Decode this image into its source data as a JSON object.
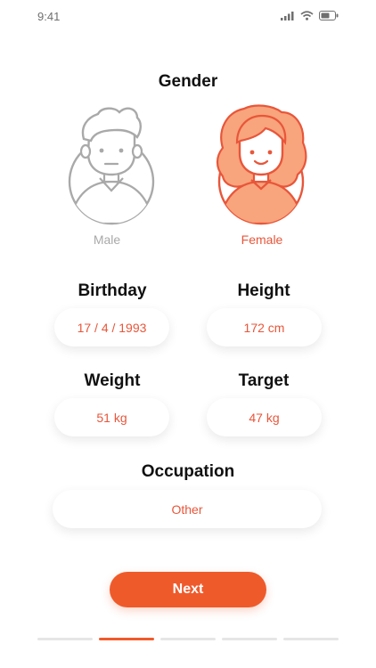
{
  "status_bar": {
    "time": "9:41"
  },
  "gender": {
    "title": "Gender",
    "options": [
      {
        "label": "Male",
        "selected": false,
        "color": "#a9a9a9"
      },
      {
        "label": "Female",
        "selected": true,
        "color": "#e8563a"
      }
    ]
  },
  "fields": {
    "birthday": {
      "label": "Birthday",
      "value": "17 / 4 / 1993"
    },
    "height": {
      "label": "Height",
      "value": "172 cm"
    },
    "weight": {
      "label": "Weight",
      "value": "51 kg"
    },
    "target": {
      "label": "Target",
      "value": "47 kg"
    },
    "occupation": {
      "label": "Occupation",
      "value": "Other"
    }
  },
  "next_button": {
    "label": "Next"
  },
  "progress": {
    "steps": 5,
    "current_step": 2
  },
  "colors": {
    "accent": "#ef5a2b",
    "accent_light": "#f8a47c",
    "inactive": "#a9a9a9"
  },
  "icons": [
    "signal-icon",
    "wifi-icon",
    "battery-icon",
    "male-avatar-icon",
    "female-avatar-icon"
  ]
}
